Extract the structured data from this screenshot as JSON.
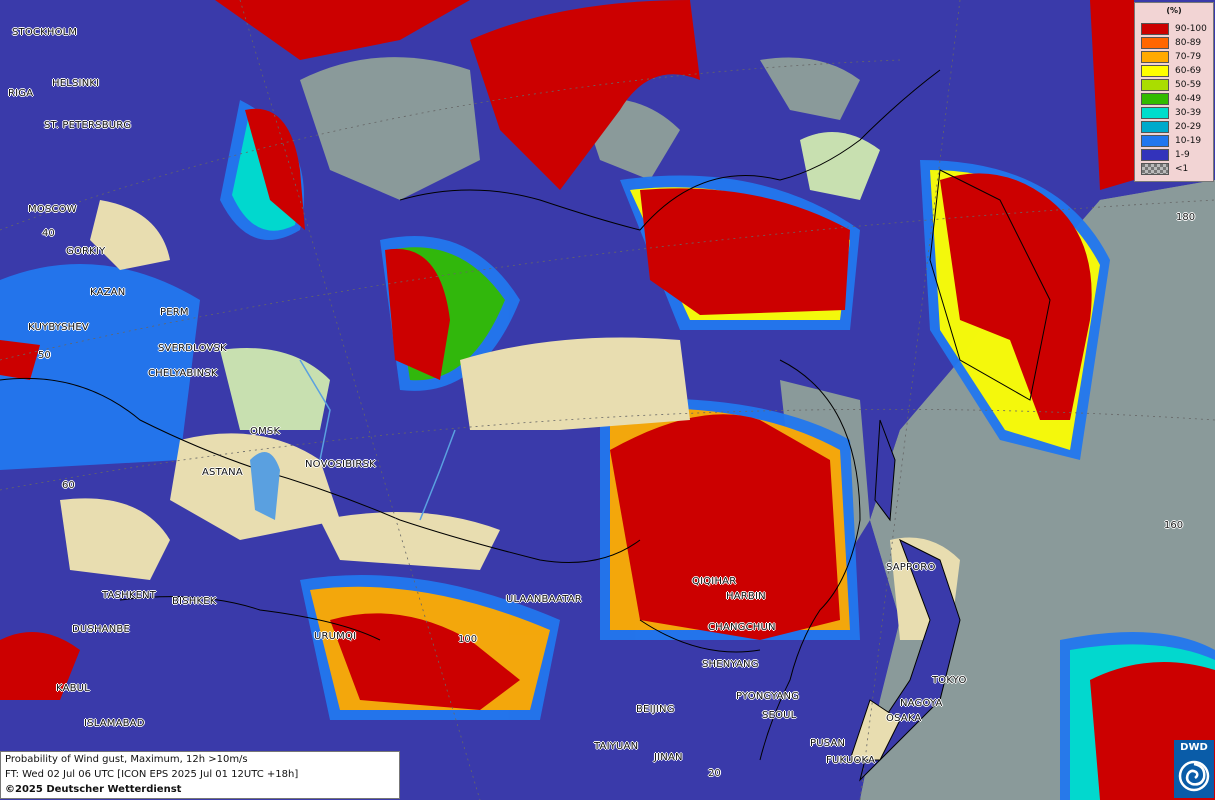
{
  "cities": [
    {
      "name": "STOCKHOLM"
    },
    {
      "name": "HELSINKI"
    },
    {
      "name": "RIGA"
    },
    {
      "name": "ST. PETERSBURG"
    },
    {
      "name": "MOSCOW"
    },
    {
      "name": "GORKIY"
    },
    {
      "name": "KAZAN"
    },
    {
      "name": "PERM"
    },
    {
      "name": "KUYBYSHEV"
    },
    {
      "name": "SVERDLOVSK"
    },
    {
      "name": "CHELYABINSK"
    },
    {
      "name": "OMSK"
    },
    {
      "name": "ASTANA"
    },
    {
      "name": "NOVOSIBIRSK"
    },
    {
      "name": "TASHKENT"
    },
    {
      "name": "BISHKEK"
    },
    {
      "name": "DUSHANBE"
    },
    {
      "name": "URUMQI"
    },
    {
      "name": "KABUL"
    },
    {
      "name": "ISLAMABAD"
    },
    {
      "name": "ULAANBAATAR"
    },
    {
      "name": "QIQIHAR"
    },
    {
      "name": "HARBIN"
    },
    {
      "name": "CHANGCHUN"
    },
    {
      "name": "SHENYANG"
    },
    {
      "name": "PYONGYANG"
    },
    {
      "name": "SEOUL"
    },
    {
      "name": "BEIJING"
    },
    {
      "name": "TAIYUAN"
    },
    {
      "name": "JINAN"
    },
    {
      "name": "PUSAN"
    },
    {
      "name": "FUKUOKA"
    },
    {
      "name": "OSAKA"
    },
    {
      "name": "NAGOYA"
    },
    {
      "name": "TOKYO"
    },
    {
      "name": "SAPPORO"
    }
  ],
  "grid_labels": [
    "40",
    "50",
    "60",
    "100",
    "180",
    "160",
    "20"
  ],
  "legend": {
    "unit": "(%)",
    "items": [
      {
        "label": "90-100",
        "color": "#cc0000"
      },
      {
        "label": "80-89",
        "color": "#ff6600"
      },
      {
        "label": "70-79",
        "color": "#ffaa00"
      },
      {
        "label": "60-69",
        "color": "#ffff00"
      },
      {
        "label": "50-59",
        "color": "#aadd00"
      },
      {
        "label": "40-49",
        "color": "#33bb00"
      },
      {
        "label": "30-39",
        "color": "#00ddcc"
      },
      {
        "label": "20-29",
        "color": "#00aacc"
      },
      {
        "label": "10-19",
        "color": "#2277ee"
      },
      {
        "label": "1-9",
        "color": "#3333bb"
      },
      {
        "label": "<1",
        "color": "#999999"
      }
    ]
  },
  "info": {
    "line1": "Probability of Wind gust, Maximum, 12h >10m/s",
    "line2": "FT: Wed 02 Jul 06 UTC [ICON EPS 2025 Jul 01 12UTC +18h]",
    "line3": "©2025 Deutscher Wetterdienst"
  },
  "logo": {
    "text": "DWD",
    "icon": "dwd-swirl-icon"
  }
}
